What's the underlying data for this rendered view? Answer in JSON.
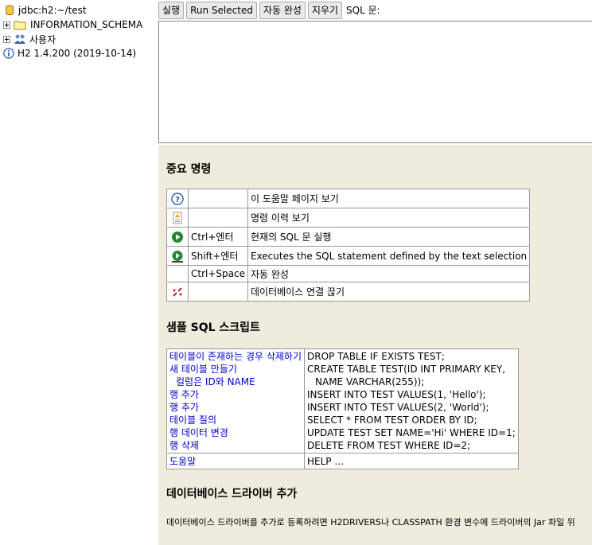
{
  "tree": {
    "connection": "jdbc:h2:~/test",
    "schema": "INFORMATION_SCHEMA",
    "users": "사용자",
    "version": "H2 1.4.200 (2019-10-14)"
  },
  "toolbar": {
    "run": "실행",
    "run_selected": "Run Selected",
    "autocomplete": "자동 완성",
    "clear": "지우기",
    "sql_label": "SQL 문:"
  },
  "help": {
    "important_title": "중요 명령",
    "commands": [
      {
        "icon": "help-icon",
        "key": "",
        "desc": "이 도움말 페이지 보기"
      },
      {
        "icon": "history-icon",
        "key": "",
        "desc": "명령 이력 보기"
      },
      {
        "icon": "run-icon",
        "key": "Ctrl+엔터",
        "desc": "현재의 SQL 문 실행"
      },
      {
        "icon": "run-selected-icon",
        "key": "Shift+엔터",
        "desc": "Executes the SQL statement defined by the text selection"
      },
      {
        "icon": "",
        "key": "Ctrl+Space",
        "desc": "자동 완성"
      },
      {
        "icon": "disconnect-icon",
        "key": "",
        "desc": "데이터베이스 연결 끊기"
      }
    ],
    "sample_title": "샘플 SQL 스크립트",
    "samples": [
      {
        "label": "테이블이 존재하는 경우 삭제하기",
        "code": "DROP TABLE IF EXISTS TEST;"
      },
      {
        "label": "새 테이블 만들기",
        "code": "CREATE TABLE TEST(ID INT PRIMARY KEY,"
      },
      {
        "label": "  컬럼은 ID와 NAME",
        "code": "   NAME VARCHAR(255));"
      },
      {
        "label": "행 추가",
        "code": "INSERT INTO TEST VALUES(1, 'Hello');"
      },
      {
        "label": "행 추가",
        "code": "INSERT INTO TEST VALUES(2, 'World');"
      },
      {
        "label": "테이블 질의",
        "code": "SELECT * FROM TEST ORDER BY ID;"
      },
      {
        "label": "행 데이터 변경",
        "code": "UPDATE TEST SET NAME='Hi' WHERE ID=1;"
      },
      {
        "label": "행 삭제",
        "code": "DELETE FROM TEST WHERE ID=2;"
      }
    ],
    "help_label": "도움말",
    "help_code": "HELP ...",
    "driver_title": "데이터베이스 드라이버 추가",
    "driver_text": "데이터베이스 드라이버를 추가로 등록하려면 H2DRIVERS나 CLASSPATH 환경 변수에 드라이버의 Jar 파일 위"
  }
}
